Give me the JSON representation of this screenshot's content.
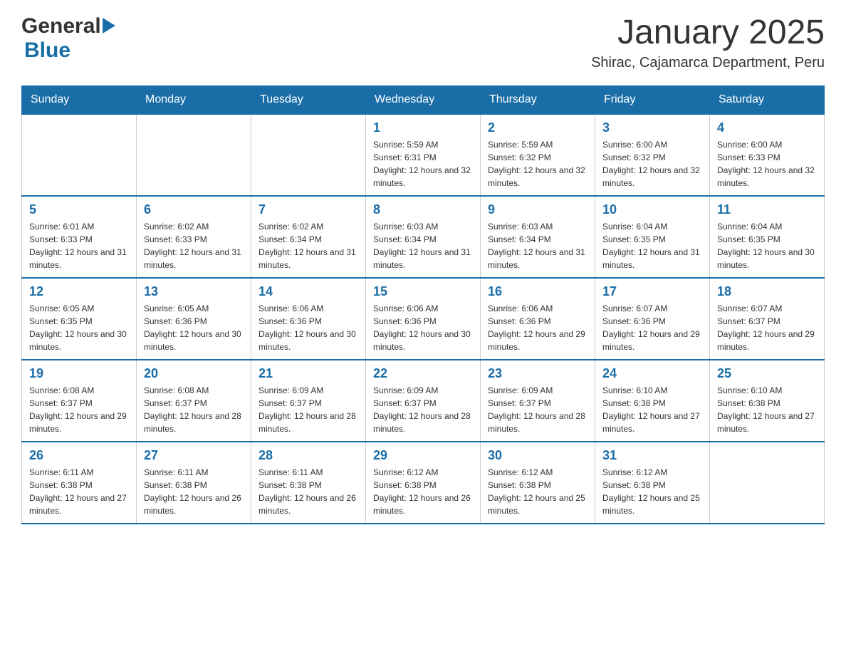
{
  "header": {
    "title": "January 2025",
    "location": "Shirac, Cajamarca Department, Peru",
    "logo_general": "General",
    "logo_blue": "Blue"
  },
  "days_of_week": [
    "Sunday",
    "Monday",
    "Tuesday",
    "Wednesday",
    "Thursday",
    "Friday",
    "Saturday"
  ],
  "weeks": [
    [
      {
        "day": "",
        "info": ""
      },
      {
        "day": "",
        "info": ""
      },
      {
        "day": "",
        "info": ""
      },
      {
        "day": "1",
        "info": "Sunrise: 5:59 AM\nSunset: 6:31 PM\nDaylight: 12 hours and 32 minutes."
      },
      {
        "day": "2",
        "info": "Sunrise: 5:59 AM\nSunset: 6:32 PM\nDaylight: 12 hours and 32 minutes."
      },
      {
        "day": "3",
        "info": "Sunrise: 6:00 AM\nSunset: 6:32 PM\nDaylight: 12 hours and 32 minutes."
      },
      {
        "day": "4",
        "info": "Sunrise: 6:00 AM\nSunset: 6:33 PM\nDaylight: 12 hours and 32 minutes."
      }
    ],
    [
      {
        "day": "5",
        "info": "Sunrise: 6:01 AM\nSunset: 6:33 PM\nDaylight: 12 hours and 31 minutes."
      },
      {
        "day": "6",
        "info": "Sunrise: 6:02 AM\nSunset: 6:33 PM\nDaylight: 12 hours and 31 minutes."
      },
      {
        "day": "7",
        "info": "Sunrise: 6:02 AM\nSunset: 6:34 PM\nDaylight: 12 hours and 31 minutes."
      },
      {
        "day": "8",
        "info": "Sunrise: 6:03 AM\nSunset: 6:34 PM\nDaylight: 12 hours and 31 minutes."
      },
      {
        "day": "9",
        "info": "Sunrise: 6:03 AM\nSunset: 6:34 PM\nDaylight: 12 hours and 31 minutes."
      },
      {
        "day": "10",
        "info": "Sunrise: 6:04 AM\nSunset: 6:35 PM\nDaylight: 12 hours and 31 minutes."
      },
      {
        "day": "11",
        "info": "Sunrise: 6:04 AM\nSunset: 6:35 PM\nDaylight: 12 hours and 30 minutes."
      }
    ],
    [
      {
        "day": "12",
        "info": "Sunrise: 6:05 AM\nSunset: 6:35 PM\nDaylight: 12 hours and 30 minutes."
      },
      {
        "day": "13",
        "info": "Sunrise: 6:05 AM\nSunset: 6:36 PM\nDaylight: 12 hours and 30 minutes."
      },
      {
        "day": "14",
        "info": "Sunrise: 6:06 AM\nSunset: 6:36 PM\nDaylight: 12 hours and 30 minutes."
      },
      {
        "day": "15",
        "info": "Sunrise: 6:06 AM\nSunset: 6:36 PM\nDaylight: 12 hours and 30 minutes."
      },
      {
        "day": "16",
        "info": "Sunrise: 6:06 AM\nSunset: 6:36 PM\nDaylight: 12 hours and 29 minutes."
      },
      {
        "day": "17",
        "info": "Sunrise: 6:07 AM\nSunset: 6:36 PM\nDaylight: 12 hours and 29 minutes."
      },
      {
        "day": "18",
        "info": "Sunrise: 6:07 AM\nSunset: 6:37 PM\nDaylight: 12 hours and 29 minutes."
      }
    ],
    [
      {
        "day": "19",
        "info": "Sunrise: 6:08 AM\nSunset: 6:37 PM\nDaylight: 12 hours and 29 minutes."
      },
      {
        "day": "20",
        "info": "Sunrise: 6:08 AM\nSunset: 6:37 PM\nDaylight: 12 hours and 28 minutes."
      },
      {
        "day": "21",
        "info": "Sunrise: 6:09 AM\nSunset: 6:37 PM\nDaylight: 12 hours and 28 minutes."
      },
      {
        "day": "22",
        "info": "Sunrise: 6:09 AM\nSunset: 6:37 PM\nDaylight: 12 hours and 28 minutes."
      },
      {
        "day": "23",
        "info": "Sunrise: 6:09 AM\nSunset: 6:37 PM\nDaylight: 12 hours and 28 minutes."
      },
      {
        "day": "24",
        "info": "Sunrise: 6:10 AM\nSunset: 6:38 PM\nDaylight: 12 hours and 27 minutes."
      },
      {
        "day": "25",
        "info": "Sunrise: 6:10 AM\nSunset: 6:38 PM\nDaylight: 12 hours and 27 minutes."
      }
    ],
    [
      {
        "day": "26",
        "info": "Sunrise: 6:11 AM\nSunset: 6:38 PM\nDaylight: 12 hours and 27 minutes."
      },
      {
        "day": "27",
        "info": "Sunrise: 6:11 AM\nSunset: 6:38 PM\nDaylight: 12 hours and 26 minutes."
      },
      {
        "day": "28",
        "info": "Sunrise: 6:11 AM\nSunset: 6:38 PM\nDaylight: 12 hours and 26 minutes."
      },
      {
        "day": "29",
        "info": "Sunrise: 6:12 AM\nSunset: 6:38 PM\nDaylight: 12 hours and 26 minutes."
      },
      {
        "day": "30",
        "info": "Sunrise: 6:12 AM\nSunset: 6:38 PM\nDaylight: 12 hours and 25 minutes."
      },
      {
        "day": "31",
        "info": "Sunrise: 6:12 AM\nSunset: 6:38 PM\nDaylight: 12 hours and 25 minutes."
      },
      {
        "day": "",
        "info": ""
      }
    ]
  ]
}
